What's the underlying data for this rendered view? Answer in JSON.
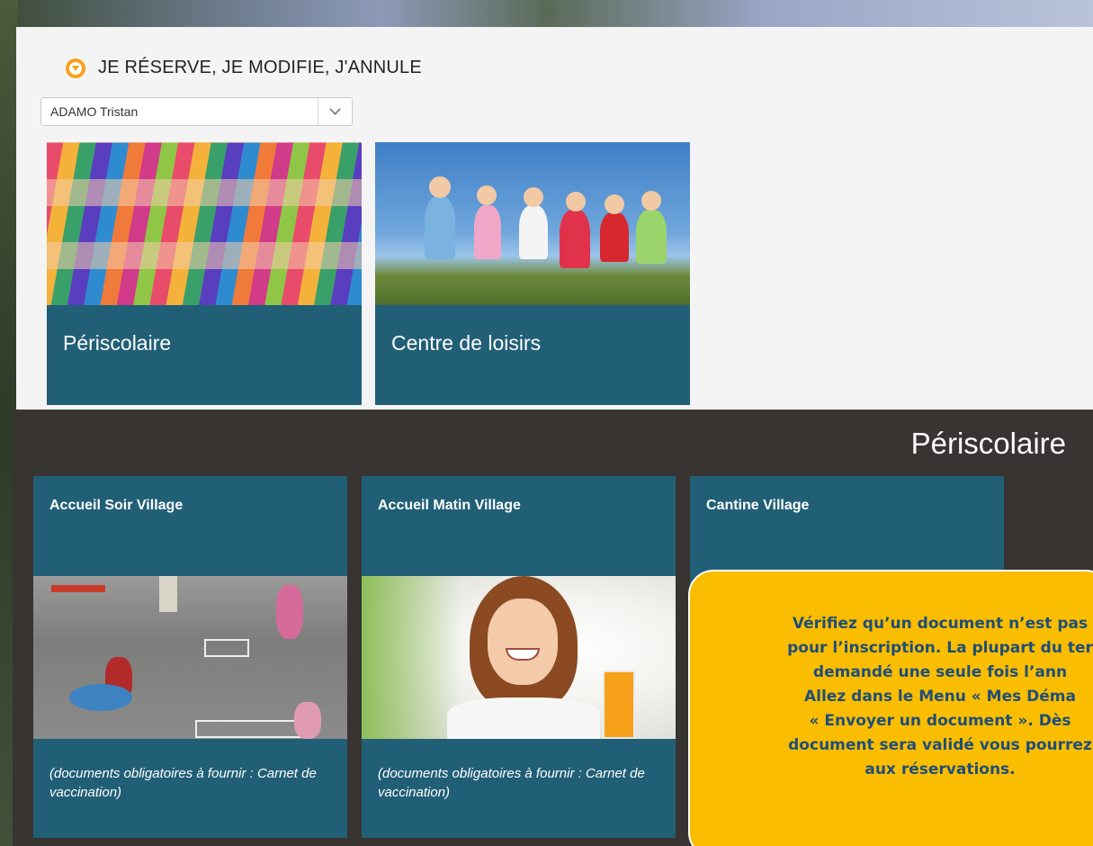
{
  "reservation": {
    "title": "JE RÉSERVE, JE MODIFIE, J'ANNULE",
    "child_select": {
      "value": "ADAMO Tristan"
    },
    "categories": [
      {
        "label": "Périscolaire"
      },
      {
        "label": "Centre de loisirs"
      }
    ]
  },
  "periscolaire": {
    "title": "Périscolaire",
    "activities": [
      {
        "name": "Accueil Soir Village",
        "docs": "(documents obligatoires à fournir : Carnet de vaccination)"
      },
      {
        "name": "Accueil Matin Village",
        "docs": "(documents obligatoires à fournir : Carnet de vaccination)"
      },
      {
        "name": "Cantine Village",
        "docs": ""
      }
    ]
  },
  "tooltip": {
    "lines": [
      "Vérifiez qu’un document n’est pas",
      "pour l’inscription. La plupart du ter",
      "demandé une seule fois l’ann",
      "Allez dans le Menu « Mes Déma",
      "« Envoyer un document ». Dès",
      "document sera validé vous pourrez",
      "aux réservations."
    ]
  },
  "colors": {
    "card_blue": "#215f76",
    "accent_orange": "#f7a21b",
    "tooltip_yellow": "#fbbd00",
    "tooltip_text": "#1f4e79"
  }
}
